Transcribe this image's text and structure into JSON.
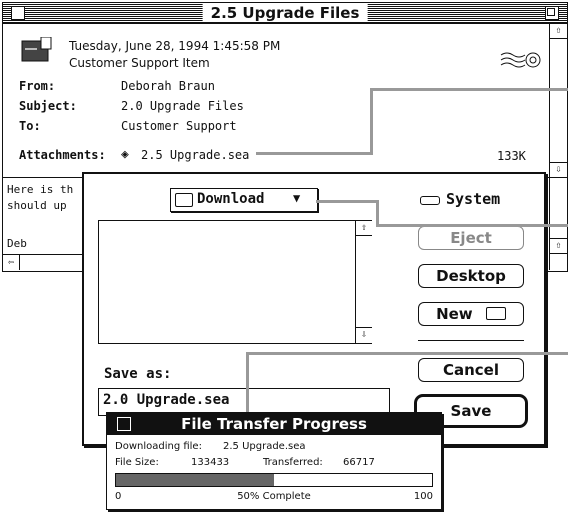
{
  "mail_window": {
    "title": "2.5 Upgrade Files",
    "date": "Tuesday, June 28, 1994 1:45:58 PM",
    "item_type": "Customer Support Item",
    "from_label": "From:",
    "from_value": "Deborah Braun",
    "subject_label": "Subject:",
    "subject_value": "2.0 Upgrade Files",
    "to_label": "To:",
    "to_value": "Customer Support",
    "attachments_label": "Attachments:",
    "attachment_name": "2.5 Upgrade.sea",
    "attachment_size": "133K",
    "body_line1": "Here is th",
    "body_line2": "should up",
    "body_line3": "Deb"
  },
  "save_dialog": {
    "folder_popup": "Download",
    "disk_name": "System",
    "eject_label": "Eject",
    "desktop_label": "Desktop",
    "new_label": "New",
    "cancel_label": "Cancel",
    "save_label": "Save",
    "save_as_label": "Save as:",
    "save_as_value": "2.0 Upgrade.sea"
  },
  "progress_window": {
    "title": "File Transfer Progress",
    "downloading_label": "Downloading file:",
    "downloading_value": "2.5 Upgrade.sea",
    "file_size_label": "File Size:",
    "file_size_value": "133433",
    "transferred_label": "Transferred:",
    "transferred_value": "66717",
    "progress_fraction": 0.5,
    "min_label": "0",
    "max_label": "100",
    "status_text": "50% Complete"
  },
  "icons": [
    "document-icon",
    "postmark-stamp-icon",
    "attachment-icon",
    "folder-icon",
    "disk-icon",
    "scroll-up-arrow-icon",
    "scroll-down-arrow-icon",
    "close-box-icon",
    "zoom-box-icon"
  ]
}
